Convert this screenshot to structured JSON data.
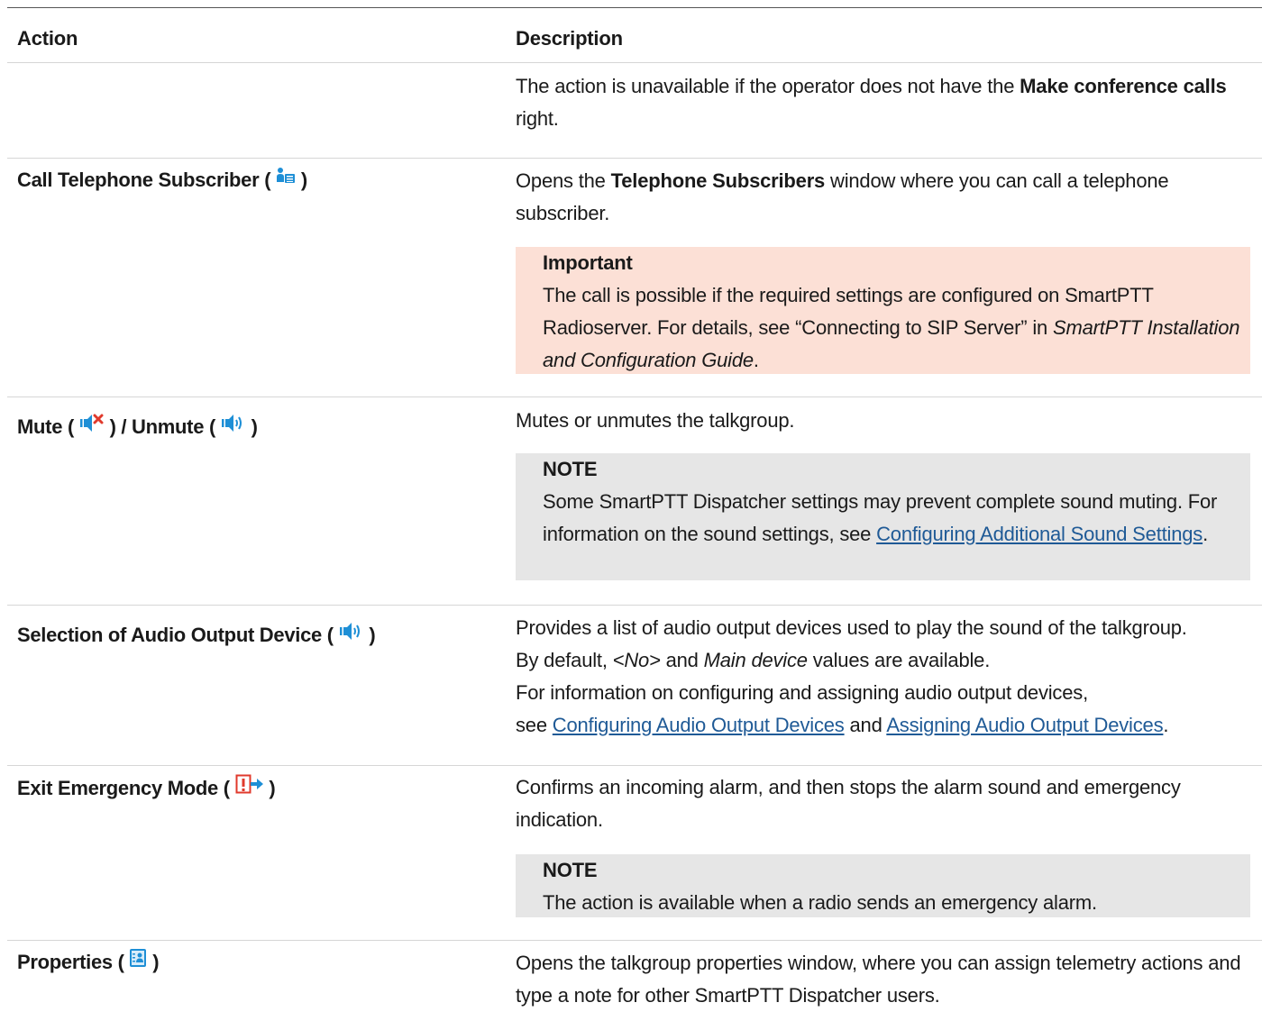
{
  "header": {
    "action": "Action",
    "description": "Description"
  },
  "row0": {
    "desc_a": "The action is unavailable if the operator does not have the ",
    "desc_b": "Make conference calls",
    "desc_c": " right."
  },
  "row1": {
    "action_label": "Call Telephone Subscriber (",
    "action_close": ")",
    "icon": "telephone-subscriber-icon",
    "desc_a": "Opens the ",
    "desc_b": "Telephone Subscribers",
    "desc_c": " window where you can call a telephone subscriber.",
    "callout_title": "Important",
    "callout_a": "The call is possible if the required settings are configured on SmartPTT Radioserver. For details, see “Connecting to SIP Server” in ",
    "callout_b": "SmartPTT Installation and Configuration Guide",
    "callout_c": "."
  },
  "row2": {
    "mute_label": "Mute (",
    "mid_label": ") / Unmute (",
    "close": ")",
    "mute_icon": "speaker-muted-icon",
    "unmute_icon": "speaker-icon",
    "desc": "Mutes or unmutes the talkgroup.",
    "callout_title": "NOTE",
    "callout_a": "Some SmartPTT Dispatcher settings may prevent complete sound muting. For information on the sound settings, see ",
    "callout_link": "Configuring Additional Sound Settings",
    "callout_c": "."
  },
  "row3": {
    "action_label": "Selection of Audio Output Device (",
    "close": ")",
    "icon": "speaker-icon",
    "line1": "Provides a list of audio output devices used to play the sound of the talkgroup.",
    "l2a": "By default, ",
    "l2b": "<No>",
    "l2c": " and ",
    "l2d": "Main device",
    "l2e": " values are available.",
    "line3": "For information on configuring and assigning audio output devices,",
    "l4a": "see ",
    "link1": "Configuring Audio Output Devices",
    "l4b": " and ",
    "link2": "Assigning Audio Output Devices",
    "l4c": "."
  },
  "row4": {
    "action_label": "Exit Emergency Mode (",
    "close": ")",
    "icon": "exit-emergency-icon",
    "desc": "Confirms an incoming alarm, and then stops the alarm sound and emergency indication.",
    "callout_title": "NOTE",
    "callout_text": "The action is available when a radio sends an emergency alarm."
  },
  "row5": {
    "action_label": "Properties (",
    "close": ")",
    "icon": "properties-icon",
    "desc": "Opens the talkgroup properties window, where you can assign telemetry actions and type a note for other SmartPTT Dispatcher users."
  },
  "colors": {
    "important_bg": "#fce0d6",
    "note_bg": "#e6e6e6",
    "link": "#1f5a96",
    "icon_blue": "#1e8fd6",
    "icon_red": "#e03a2c"
  }
}
